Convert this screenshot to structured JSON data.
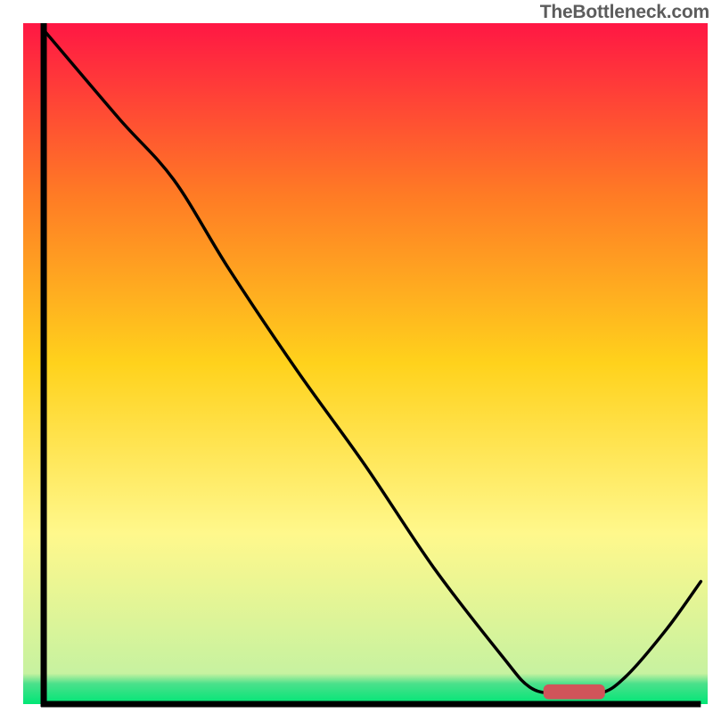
{
  "watermark": "TheBottleneck.com",
  "chart_data": {
    "type": "line",
    "title": "",
    "xlabel": "",
    "ylabel": "",
    "xlim": [
      0,
      100
    ],
    "ylim": [
      0,
      100
    ],
    "legend": false,
    "grid": false,
    "gradient": {
      "stops": [
        {
          "offset": 0.0,
          "color": "#ff1744"
        },
        {
          "offset": 0.25,
          "color": "#ff7a25"
        },
        {
          "offset": 0.5,
          "color": "#ffd21c"
        },
        {
          "offset": 0.75,
          "color": "#fff88c"
        },
        {
          "offset": 0.955,
          "color": "#c7f2a0"
        },
        {
          "offset": 0.97,
          "color": "#4be08b"
        },
        {
          "offset": 1.0,
          "color": "#00e676"
        }
      ]
    },
    "curve": [
      {
        "x": 3.0,
        "y": 99.0
      },
      {
        "x": 14.0,
        "y": 86.0
      },
      {
        "x": 22.0,
        "y": 77.0
      },
      {
        "x": 30.0,
        "y": 64.0
      },
      {
        "x": 40.0,
        "y": 49.0
      },
      {
        "x": 50.0,
        "y": 35.0
      },
      {
        "x": 60.0,
        "y": 20.0
      },
      {
        "x": 70.0,
        "y": 7.0
      },
      {
        "x": 74.0,
        "y": 2.5
      },
      {
        "x": 78.0,
        "y": 1.5
      },
      {
        "x": 84.0,
        "y": 1.5
      },
      {
        "x": 88.0,
        "y": 4.0
      },
      {
        "x": 94.0,
        "y": 11.0
      },
      {
        "x": 99.0,
        "y": 18.0
      }
    ],
    "marker": {
      "x_start": 76.0,
      "x_end": 85.0,
      "y": 1.8,
      "color": "#d1545a",
      "thickness": 2.2
    },
    "axes": {
      "left": {
        "x": 3.0,
        "y0": 0,
        "y1": 100
      },
      "bottom": {
        "y": 0.0,
        "x0": 3,
        "x1": 99
      }
    }
  }
}
